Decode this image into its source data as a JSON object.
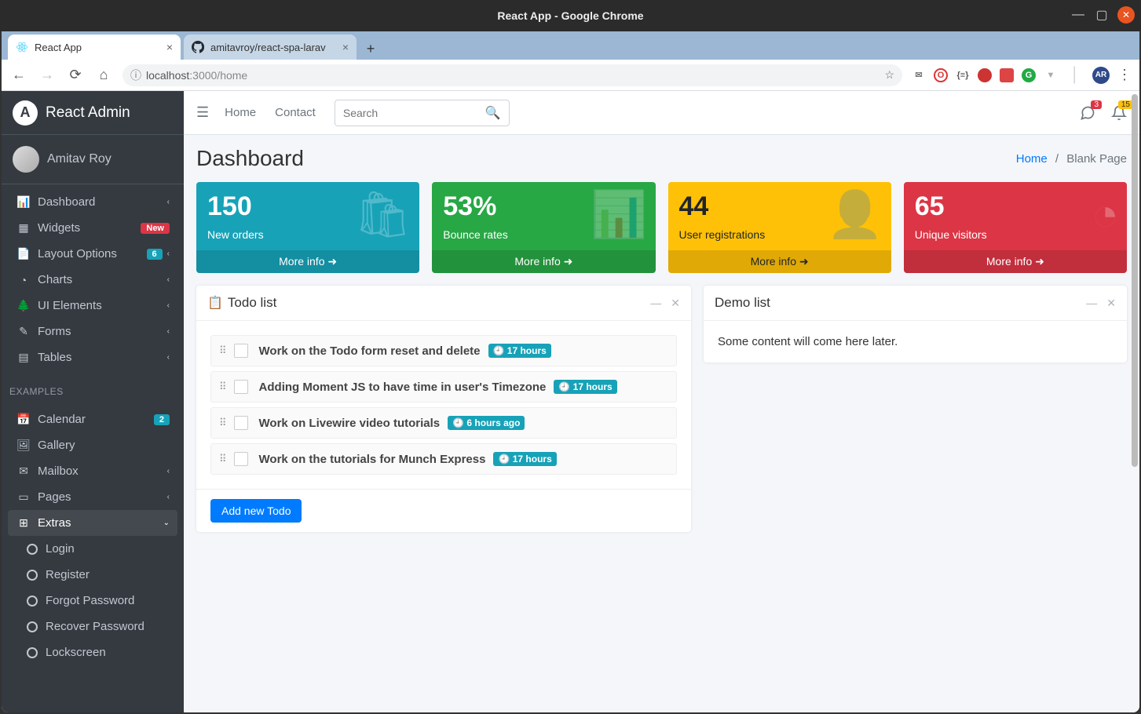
{
  "os": {
    "title": "React App - Google Chrome"
  },
  "chrome": {
    "tabs": [
      {
        "label": "React App",
        "active": true
      },
      {
        "label": "amitavroy/react-spa-larav",
        "active": false
      }
    ],
    "url_host": "localhost",
    "url_path": ":3000/home",
    "avatar_initials": "AR"
  },
  "brand": {
    "name": "React Admin",
    "initial": "A"
  },
  "user": {
    "name": "Amitav Roy"
  },
  "sidebar": {
    "header_examples": "EXAMPLES",
    "items": [
      {
        "label": "Dashboard",
        "caret": true
      },
      {
        "label": "Widgets",
        "badge": "New",
        "badge_class": "badge-new"
      },
      {
        "label": "Layout Options",
        "badge": "6",
        "badge_class": "badge-info",
        "caret": true
      },
      {
        "label": "Charts",
        "caret": true
      },
      {
        "label": "UI Elements",
        "caret": true
      },
      {
        "label": "Forms",
        "caret": true
      },
      {
        "label": "Tables",
        "caret": true
      }
    ],
    "examples": [
      {
        "label": "Calendar",
        "badge": "2",
        "badge_class": "badge-info"
      },
      {
        "label": "Gallery"
      },
      {
        "label": "Mailbox",
        "caret": true
      },
      {
        "label": "Pages",
        "caret": true
      },
      {
        "label": "Extras",
        "caret": true,
        "open": true
      }
    ],
    "extras_sub": [
      {
        "label": "Login"
      },
      {
        "label": "Register"
      },
      {
        "label": "Forgot Password"
      },
      {
        "label": "Recover Password"
      },
      {
        "label": "Lockscreen"
      }
    ]
  },
  "topnav": {
    "links": [
      "Home",
      "Contact"
    ],
    "search_placeholder": "Search",
    "msg_badge": "3",
    "bell_badge": "15"
  },
  "header": {
    "title": "Dashboard",
    "breadcrumb_home": "Home",
    "breadcrumb_sep": "/",
    "breadcrumb_current": "Blank Page"
  },
  "stats": [
    {
      "value": "150",
      "label": "New orders",
      "class": "stat-info",
      "more": "More info"
    },
    {
      "value": "53%",
      "label": "Bounce rates",
      "class": "stat-success",
      "more": "More info"
    },
    {
      "value": "44",
      "label": "User registrations",
      "class": "stat-warning",
      "more": "More info"
    },
    {
      "value": "65",
      "label": "Unique visitors",
      "class": "stat-danger",
      "more": "More info"
    }
  ],
  "todo": {
    "title": "Todo list",
    "items": [
      {
        "text": "Work on the Todo form reset and delete",
        "time": "17 hours"
      },
      {
        "text": "Adding Moment JS to have time in user's Timezone",
        "time": "17 hours"
      },
      {
        "text": "Work on Livewire video tutorials",
        "time": "6 hours ago"
      },
      {
        "text": "Work on the tutorials for Munch Express",
        "time": "17 hours"
      }
    ],
    "add_button": "Add new Todo"
  },
  "demo": {
    "title": "Demo list",
    "body": "Some content will come here later."
  }
}
